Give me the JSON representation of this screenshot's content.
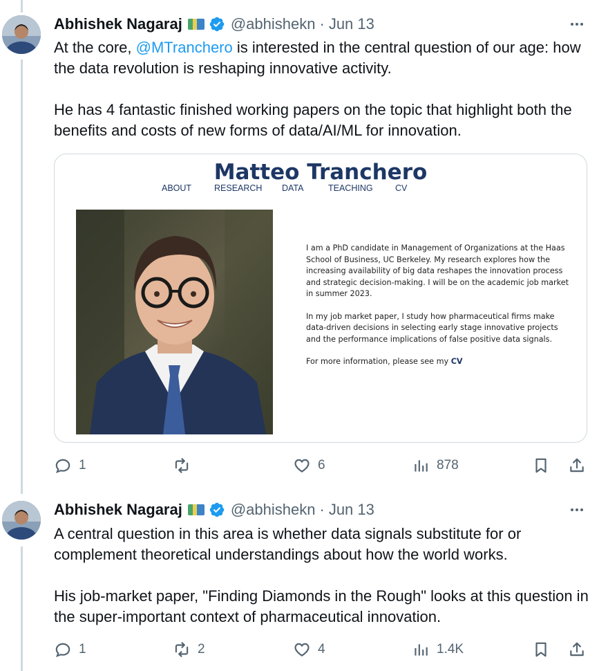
{
  "tweets": [
    {
      "author": "Abhishek Nagaraj",
      "handle": "@abhishekn",
      "separator": "·",
      "date": "Jun 13",
      "text_line1_prefix": "At the core, ",
      "mention": "@MTranchero",
      "text_line1_suffix": " is interested in the central question of our age: how the data revolution is reshaping innovative activity.",
      "text_para2": "He has 4 fantastic finished working papers on the topic that highlight both the benefits and costs of new forms of data/AI/ML for innovation.",
      "card": {
        "site_title": "Matteo Tranchero",
        "nav": [
          "ABOUT",
          "RESEARCH",
          "DATA",
          "TEACHING",
          "CV"
        ],
        "bio_para1": "I am a PhD candidate in Management of Organizations at the Haas School of Business, UC Berkeley. My research explores how the increasing availability of big data reshapes the innovation process and strategic decision-making. I will be on the academic job market in summer 2023.",
        "bio_para2": "In my job market paper, I study how pharmaceutical firms make data-driven decisions in selecting early stage innovative projects and the performance implications of false positive data signals.",
        "bio_para3_prefix": "For more information, please see my ",
        "bio_para3_link": "CV"
      },
      "stats": {
        "replies": "1",
        "retweets": "",
        "likes": "6",
        "views": "878"
      }
    },
    {
      "author": "Abhishek Nagaraj",
      "handle": "@abhishekn",
      "separator": "·",
      "date": "Jun 13",
      "text_para1": "A central question in this area is whether data signals substitute for or complement theoretical understandings about how the world works.",
      "text_para2": "His job-market paper, \"Finding Diamonds in the Rough\" looks at this question in the super-important context of pharmaceutical innovation.",
      "stats": {
        "replies": "1",
        "retweets": "2",
        "likes": "4",
        "views": "1.4K"
      }
    }
  ],
  "icons": {
    "reply": "reply-icon",
    "retweet": "retweet-icon",
    "like": "heart-icon",
    "views": "views-icon",
    "bookmark": "bookmark-icon",
    "share": "share-icon",
    "more": "more-icon",
    "verified": "verified-badge-icon",
    "flag": "map-emoji-icon"
  },
  "colors": {
    "link": "#1d9bf0",
    "muted": "#536471",
    "text": "#0f1419",
    "site_title": "#1d3766",
    "border": "#cfd9de"
  }
}
